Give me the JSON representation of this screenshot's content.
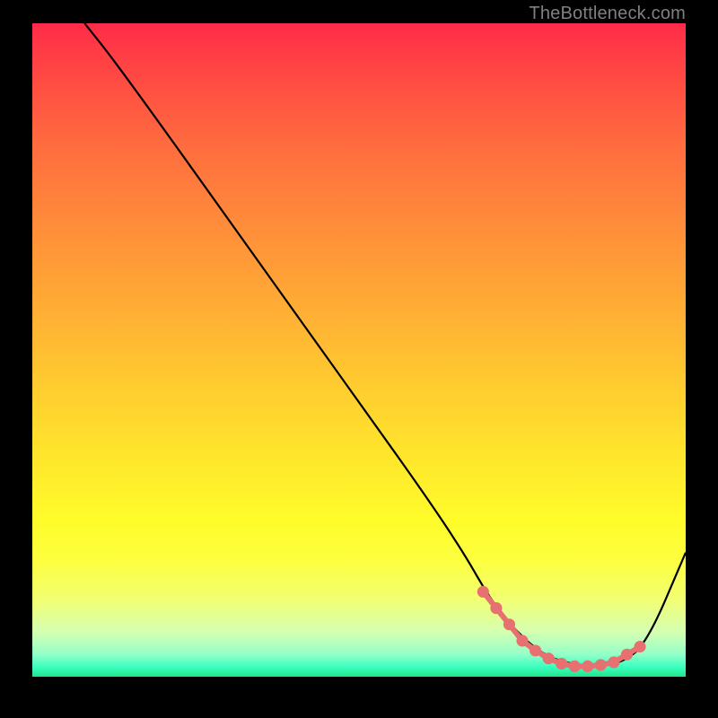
{
  "attribution": "TheBottleneck.com",
  "chart_data": {
    "type": "line",
    "title": "",
    "xlabel": "",
    "ylabel": "",
    "xlim": [
      0,
      100
    ],
    "ylim": [
      0,
      100
    ],
    "background_gradient": {
      "top": "#ff2b48",
      "mid": "#ffe52c",
      "bottom": "#1fe589"
    },
    "series": [
      {
        "name": "curve",
        "color": "#000000",
        "x": [
          8,
          12,
          20,
          30,
          40,
          50,
          60,
          66,
          70,
          74,
          78,
          82,
          86,
          90,
          94,
          100
        ],
        "y": [
          100,
          95,
          84,
          70,
          56,
          42,
          28,
          19,
          12,
          7,
          3.5,
          2,
          1.6,
          2,
          5,
          19
        ]
      }
    ],
    "markers": {
      "name": "highlighted-range",
      "color": "#e77070",
      "x": [
        69,
        71,
        73,
        75,
        77,
        79,
        81,
        83,
        85,
        87,
        89,
        91,
        93
      ],
      "y": [
        13,
        10.5,
        8,
        5.5,
        4,
        2.8,
        2,
        1.6,
        1.6,
        1.8,
        2.2,
        3.4,
        4.6
      ]
    }
  }
}
